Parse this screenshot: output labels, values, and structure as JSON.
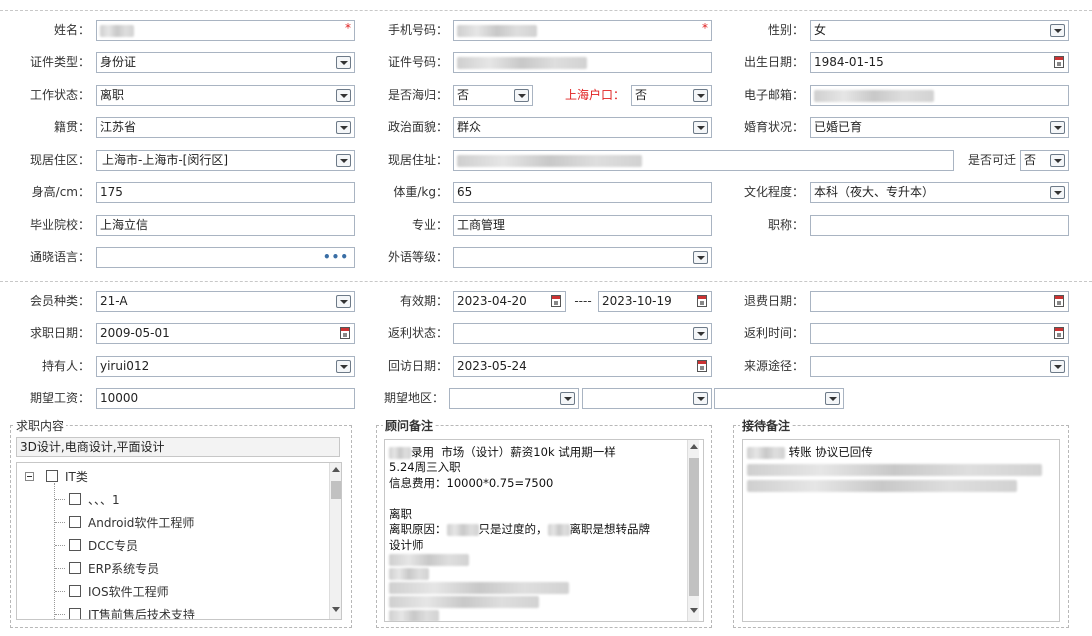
{
  "personal": {
    "name_label": "姓名：",
    "phone_label": "手机号码：",
    "gender_label": "性别：",
    "gender_value": "女",
    "id_type_label": "证件类型：",
    "id_type_value": "身份证",
    "id_number_label": "证件号码：",
    "birth_label": "出生日期：",
    "birth_value": "1984-01-15",
    "work_status_label": "工作状态：",
    "work_status_value": "离职",
    "returnee_label": "是否海归：",
    "returnee_value": "否",
    "shanghai_hukou_label": "上海户口：",
    "shanghai_hukou_value": "否",
    "email_label": "电子邮箱：",
    "native_label": "籍贯：",
    "native_value": "江苏省",
    "political_label": "政治面貌：",
    "political_value": "群众",
    "marital_label": "婚育状况：",
    "marital_value": "已婚已育",
    "residence_area_label": "现居住区：",
    "residence_area_value": "上海市-上海市-[闵行区]",
    "residence_addr_label": "现居住址：",
    "relocate_label": "是否可迁",
    "relocate_value": "否",
    "height_label": "身高/cm：",
    "height_value": "175",
    "weight_label": "体重/kg：",
    "weight_value": "65",
    "education_label": "文化程度：",
    "education_value": "本科（夜大、专升本）",
    "school_label": "毕业院校：",
    "school_value": "上海立信",
    "major_label": "专业：",
    "major_value": "工商管理",
    "title_label": "职称：",
    "language_label": "通晓语言：",
    "foreign_level_label": "外语等级："
  },
  "membership": {
    "type_label": "会员种类：",
    "type_value": "21-A",
    "valid_label": "有效期：",
    "valid_from": "2023-04-20",
    "valid_sep": "----",
    "valid_to": "2023-10-19",
    "refund_date_label": "退费日期：",
    "job_date_label": "求职日期：",
    "job_date_value": "2009-05-01",
    "rebate_status_label": "返利状态：",
    "rebate_time_label": "返利时间：",
    "holder_label": "持有人：",
    "holder_value": "yirui012",
    "visit_date_label": "回访日期：",
    "visit_date_value": "2023-05-24",
    "source_label": "来源途径：",
    "salary_label": "期望工资：",
    "salary_value": "10000",
    "region_label": "期望地区："
  },
  "job_panel": {
    "title": "求职内容",
    "selected": "3D设计,电商设计,平面设计",
    "tree_root": "IT类",
    "tree_items": [
      "、、、1",
      "Android软件工程师",
      "DCC专员",
      "ERP系统专员",
      "IOS软件工程师",
      "IT售前售后技术支持"
    ]
  },
  "consultant_panel": {
    "title": "顾问备注",
    "lines": [
      "录用  市场（设计）薪资10k 试用期一样",
      "5.24周三入职",
      "信息费用：10000*0.75=7500",
      "",
      "离职",
      "离职原因：",
      "只是过度的，",
      "离职是想转品牌",
      "设计师"
    ]
  },
  "reception_panel": {
    "title": "接待备注",
    "line1": "转账 协议已回传"
  }
}
